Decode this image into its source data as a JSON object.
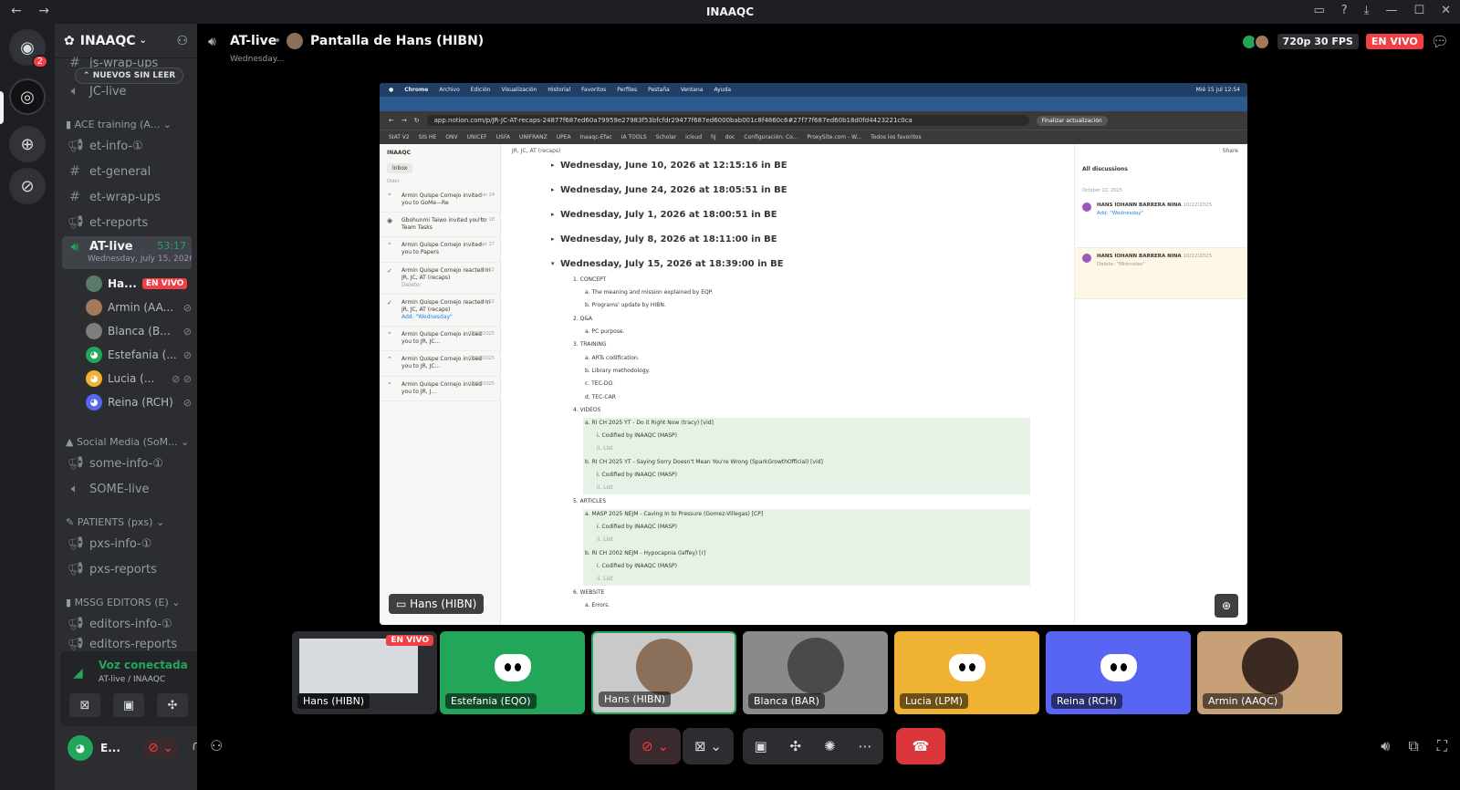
{
  "window": {
    "title": "INAAQC",
    "nav_back": "←",
    "nav_forward": "→",
    "controls": [
      "▭",
      "?",
      "⤓",
      "—",
      "☐",
      "✕"
    ]
  },
  "guilds": {
    "home_badge": "2"
  },
  "server": {
    "name": "INAAQC",
    "unread_pill": "NUEVOS SIN LEER"
  },
  "channels": {
    "top_partial": "js-wrap-ups",
    "jc_live": "JC-live",
    "cat_ace": "ACE training (A...",
    "et_info": "et-info-①",
    "et_general": "et-general",
    "et_wrap_ups": "et-wrap-ups",
    "et_reports": "et-reports",
    "at_live": "AT-live",
    "at_live_timer": "53:17",
    "at_live_sub": "Wednesday, July 15, 2026",
    "cat_social": "Social Media (SoM...",
    "some_info": "some-info-①",
    "some_live": "SOME-live",
    "cat_patients": "PATIENTS (pxs)",
    "pxs_info": "pxs-info-①",
    "pxs_reports": "pxs-reports",
    "cat_mssg": "MSSG EDITORS (E)",
    "editors_info": "editors-info-①",
    "editors_reports": "editors-reports"
  },
  "voice_users": [
    {
      "name": "Ha...",
      "live": "EN VIVO",
      "color": "#5b7b6a"
    },
    {
      "name": "Armin (AA...",
      "color": "#a4785a"
    },
    {
      "name": "Blanca (B...",
      "color": "#7d7d7d"
    },
    {
      "name": "Estefania (...",
      "color": "#23a55a"
    },
    {
      "name": "Lucia (...",
      "color": "#f0b232"
    },
    {
      "name": "Reina (RCH)",
      "color": "#5865f2"
    }
  ],
  "voice_panel": {
    "status": "Voz conectada",
    "location": "AT-live / INAAQC"
  },
  "user_panel": {
    "name": "E..."
  },
  "header": {
    "channel": "AT-live",
    "screen": "Pantalla de Hans (HIBN)",
    "date": "Wednesday...",
    "quality": "720p 30 FPS",
    "live": "EN VIVO"
  },
  "stream": {
    "menubar": [
      "Chrome",
      "Archivo",
      "Edición",
      "Visualización",
      "Historial",
      "Favoritos",
      "Perfiles",
      "Pestaña",
      "Ventana",
      "Ayuda"
    ],
    "clock": "Mié 15 jul 12:54",
    "url": "app.notion.com/p/JR-JC-AT-recaps-24877f687ed60a79959e27983f53bfcfdr29477f687ed6000bab001c8f4860c6#27f77f687ed60b18d0fd4423221c0ca",
    "update_btn": "Finalizar actualización",
    "bookmarks": [
      "SIAT V2",
      "SIS HE",
      "ONV",
      "UNICEF",
      "USFA",
      "UNIFRANZ",
      "UPEA",
      "Inaaqc-Efac",
      "IA TOOLS",
      "Scholar",
      "icloud",
      "hJ",
      "doc",
      "Configuración: Co...",
      "ProxySite.com - W...",
      "Todos los favoritos"
    ],
    "tag": "Hans (HIBN)"
  },
  "inbox": {
    "title": "INAAQC",
    "tab": "Inbox",
    "older": "Older",
    "items": [
      {
        "text": "Armin Quispe Cornejo invited you to GoMe—Re",
        "date": "Jun 24"
      },
      {
        "text": "Gbohunmi Taiwo invited you to Team Tasks",
        "date": "May 18"
      },
      {
        "text": "Armin Quispe Cornejo invited you to Papers",
        "date": "Apr 27"
      },
      {
        "text": "Armin Quispe Cornejo reacted in JR, JC, AT (recaps)",
        "sub": "Delete:",
        "date": "Jan 22"
      },
      {
        "text": "Armin Quispe Cornejo reacted in JR, JC, AT (recaps)",
        "sub": "Add: \"Wednesday\"",
        "date": "Jan 22"
      },
      {
        "text": "Armin Quispe Cornejo invited you to JR, JC...",
        "date": "09/22/2025"
      },
      {
        "text": "Armin Quispe Cornejo invited you to JR, JC...",
        "date": "09/22/2025"
      },
      {
        "text": "Armin Quispe Cornejo invited you to JR, J...",
        "date": "09/04/2025"
      }
    ]
  },
  "doc": {
    "crumb": "JR, JC, AT (recaps)",
    "headings": [
      "Wednesday, June 10, 2026 at 12:15:16 in BE",
      "Wednesday, June 24, 2026 at 18:05:51 in BE",
      "Wednesday, July 1, 2026 at 18:00:51 in BE",
      "Wednesday, July 8, 2026 at 18:11:00 in BE",
      "Wednesday, July 15, 2026 at 18:39:00 in BE"
    ],
    "lines": [
      "1.  CONCEPT",
      "a.  The meaning and mission explained by EQP.",
      "b.  Programs' update by HIBN.",
      "2.  Q&A",
      "a.  PC purpose.",
      "3.  TRAINING",
      "a.  ARTs codification.",
      "b.  Library methodology.",
      "c.  TEC-DO.",
      "d.  TEC-CAR",
      "4.  VIDEOS",
      "a.  RI CH 2025 YT - Do it Right Now (tracy) [vid]",
      "i.   Codified by INAAQC (MASP)",
      "ii.  List",
      "b.  RI CH 2025 YT - Saying Sorry Doesn't Mean You're Wrong (SparkGrowthOfficial) [vid]",
      "i.   Codified by INAAQC (MASP)",
      "ii.  List",
      "5.  ARTICLES",
      "a.  MASP 2025 NEJM - Caving In to Pressure (Gomez-Villegas) [CP]",
      "i.   Codified by INAAQC (MASP)",
      "ii.  List",
      "b.  RI CH 2002 NEJM - Hypocapnia (laffey) [r]",
      "i.   Codified by INAAQC (MASP)",
      "ii.  List",
      "6.  WEBSITE",
      "a.  Errors."
    ]
  },
  "discussions": {
    "title": "All discussions",
    "date": "October 22, 2025",
    "cards": [
      {
        "name": "HANS IOHANN BARRERA NINA",
        "date": "10/22/2025",
        "text": "Add: \"Wednesday\""
      },
      {
        "name": "HANS IOHANN BARRERA NINA",
        "date": "10/22/2025",
        "text": "Delete: \"Miércoles\""
      }
    ],
    "share": "Share"
  },
  "tiles": [
    {
      "name": "Hans (HIBN)",
      "live": "EN VIVO",
      "bg": "#2b2d31"
    },
    {
      "name": "Estefania (EQO)",
      "bg": "#23a55a"
    },
    {
      "name": "Hans (HIBN)",
      "bg": "#c9c9c9"
    },
    {
      "name": "Blanca (BAR)",
      "bg": "#8a8a8a"
    },
    {
      "name": "Lucia (LPM)",
      "bg": "#f0b232"
    },
    {
      "name": "Reina (RCH)",
      "bg": "#5865f2"
    },
    {
      "name": "Armin (AAQC)",
      "bg": "#c8a078"
    }
  ]
}
